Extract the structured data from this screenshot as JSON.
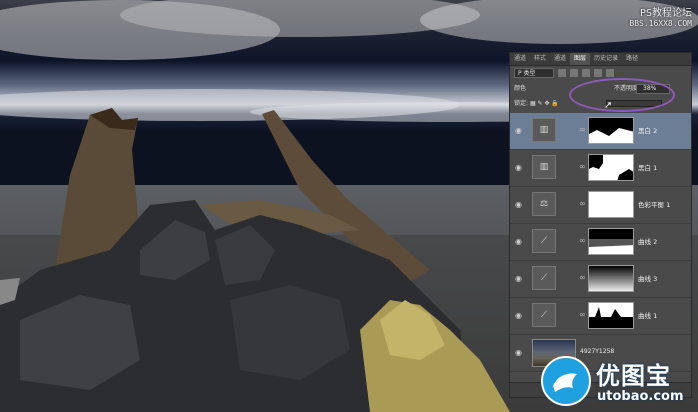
{
  "watermark_top": {
    "line1": "PS教程论坛",
    "line2": "BBS.16XX8.COM"
  },
  "watermark_bottom": {
    "cn": "优图宝",
    "en": "utobao.com"
  },
  "panel": {
    "tabs": [
      "通道",
      "样式",
      "通道",
      "图层",
      "历史记录",
      "路径"
    ],
    "active_tab_index": 3,
    "filter_kind": "P 类型",
    "blend_mode": "颜色",
    "opacity_label": "不透明度:",
    "opacity_value": "38%",
    "lock_label": "锁定:",
    "layers": [
      {
        "name": "黑白 2",
        "icon": "black-white-icon",
        "selected": true
      },
      {
        "name": "黑白 1",
        "icon": "black-white-icon",
        "selected": false
      },
      {
        "name": "色彩平衡 1",
        "icon": "color-balance-icon",
        "selected": false
      },
      {
        "name": "曲线 2",
        "icon": "curves-icon",
        "selected": false
      },
      {
        "name": "曲线 3",
        "icon": "curves-icon",
        "selected": false
      },
      {
        "name": "曲线 1",
        "icon": "curves-icon",
        "selected": false
      }
    ],
    "photo_layer_name": "4927Y1258"
  },
  "colors": {
    "highlight_circle": "#8e5bb8",
    "selected_layer": "#6c7d96",
    "watermark_blue": "#1fa0e0"
  }
}
